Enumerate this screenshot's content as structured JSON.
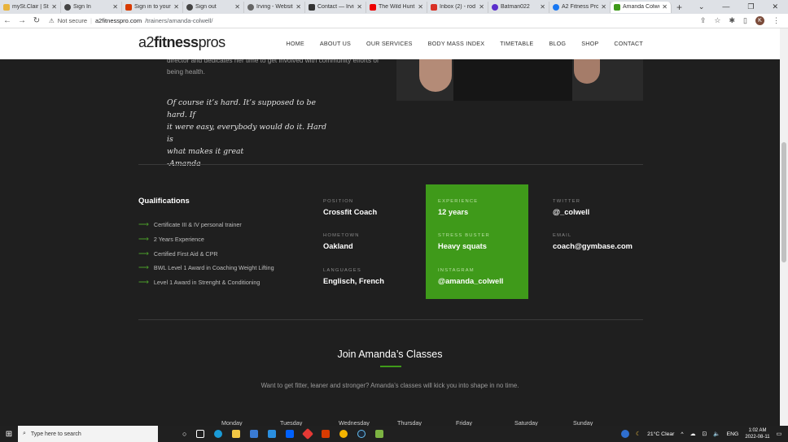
{
  "browser": {
    "tabs": [
      {
        "title": "mySt.Clair | St. C",
        "color": "#e8b33c"
      },
      {
        "title": "Sign In",
        "color": "#444"
      },
      {
        "title": "Sign in to your",
        "color": "#d83b01"
      },
      {
        "title": "Sign out",
        "color": "#444"
      },
      {
        "title": "Irving - Website",
        "color": "#666"
      },
      {
        "title": "Contact — Irvin",
        "color": "#333"
      },
      {
        "title": "The Wild Hunt",
        "color": "#e00"
      },
      {
        "title": "Inbox (2) - rod",
        "color": "#d93025"
      },
      {
        "title": "Batman022",
        "color": "#5b2ecc"
      },
      {
        "title": "A2 Fitness Profi",
        "color": "#1877f2"
      },
      {
        "title": "Amanda Colwel",
        "color": "#3f9a1a"
      }
    ],
    "active_tab": 10,
    "new_tab": "+",
    "security": "Not secure",
    "host": "a2fitnesspro.com",
    "path": "/trainers/amanda-colwell/",
    "profile_initial": "K"
  },
  "site": {
    "logo_prefix": "a2",
    "logo_bold": "fitness",
    "logo_suffix": "pros",
    "menu": [
      "HOME",
      "ABOUT US",
      "OUR SERVICES",
      "BODY MASS INDEX",
      "TIMETABLE",
      "BLOG",
      "SHOP",
      "CONTACT"
    ]
  },
  "bio": {
    "text": "director and dedicates her time to get involved with community efforts of being health."
  },
  "quote": {
    "line1": "Of course it’s hard. It’s supposed to be hard. If",
    "line2": "it were easy, everybody would do it. Hard is",
    "line3": "what makes it great",
    "line4": "-Amanda"
  },
  "qualifications": {
    "title": "Qualifications",
    "items": [
      "Certificate III & IV personal trainer",
      "2 Years Experience",
      "Certified First Aid & CPR",
      "BWL Level 1 Award in Coaching Weight Lifting",
      "Level 1 Award in Strenght & Conditioning"
    ]
  },
  "details": {
    "position": {
      "label": "POSITION",
      "value": "Crossfit Coach"
    },
    "hometown": {
      "label": "HOMETOWN",
      "value": "Oakland"
    },
    "languages": {
      "label": "LANGUAGES",
      "value": "Englisch, French"
    },
    "experience": {
      "label": "EXPERIENCE",
      "value": "12 years"
    },
    "stress_buster": {
      "label": "STRESS BUSTER",
      "value": "Heavy squats"
    },
    "instagram": {
      "label": "INSTAGRAM",
      "value": "@amanda_colwell"
    },
    "twitter": {
      "label": "TWITTER",
      "value": "@_colwell"
    },
    "email": {
      "label": "EMAIL",
      "value": "coach@gymbase.com"
    }
  },
  "classes": {
    "title": "Join Amanda’s Classes",
    "subtitle": "Want to get fitter, leaner and stronger? Amanda’s classes will kick you into shape in no time.",
    "days": [
      "Monday",
      "Tuesday",
      "Wednesday",
      "Thursday",
      "Friday",
      "Saturday",
      "Sunday"
    ]
  },
  "taskbar": {
    "search_placeholder": "Type here to search",
    "weather": "21°C  Clear",
    "lang": "ENG",
    "time": "1:02 AM",
    "date": "2022-08-11"
  },
  "colors": {
    "accent": "#3f9a1a",
    "page_bg": "#1f1f1f"
  }
}
